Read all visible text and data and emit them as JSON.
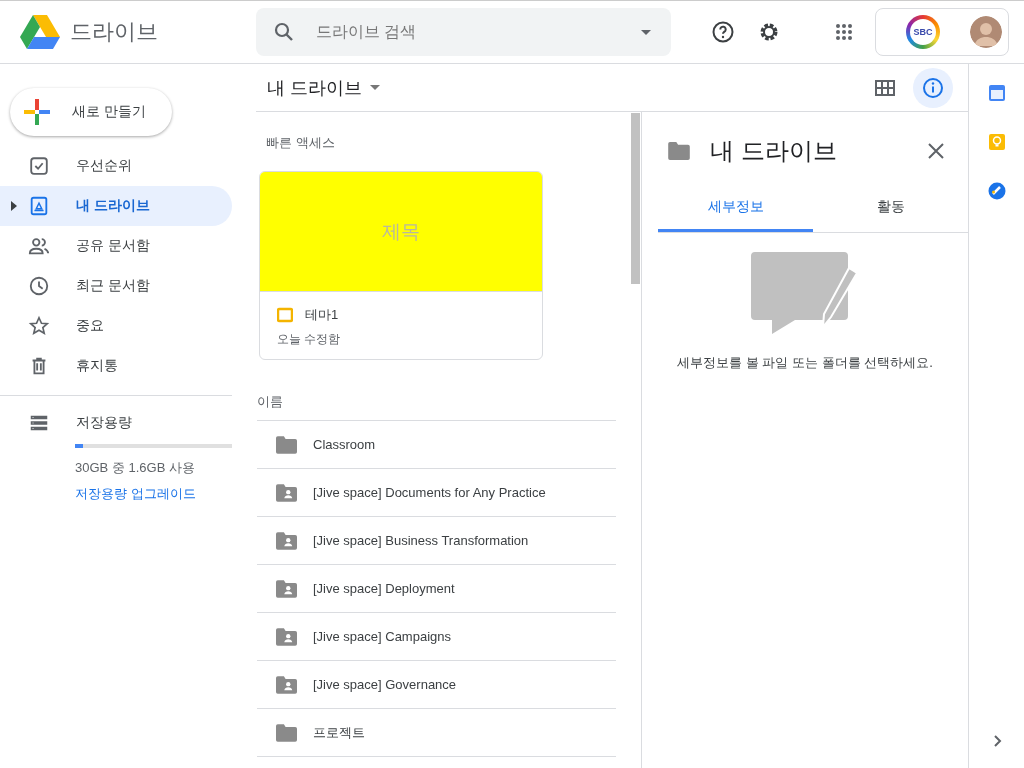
{
  "header": {
    "app_name": "드라이브",
    "search": {
      "placeholder": "드라이브 검색"
    },
    "account_logo": "SBC"
  },
  "sidebar": {
    "new_button": "새로 만들기",
    "items": [
      {
        "label": "우선순위",
        "kind": "priority",
        "selected": false
      },
      {
        "label": "내 드라이브",
        "kind": "drive",
        "selected": true
      },
      {
        "label": "공유 문서함",
        "kind": "shared",
        "selected": false
      },
      {
        "label": "최근 문서함",
        "kind": "recent",
        "selected": false
      },
      {
        "label": "중요",
        "kind": "starred",
        "selected": false
      },
      {
        "label": "휴지통",
        "kind": "trash",
        "selected": false
      }
    ],
    "storage": {
      "label": "저장용량",
      "level": 0.053,
      "usage": "30GB 중 1.6GB 사용",
      "upgrade": "저장용량 업그레이드"
    }
  },
  "main": {
    "title": "내 드라이브",
    "quick_access": {
      "heading": "빠른 액세스",
      "file": {
        "thumbnail_text": "제목",
        "name": "테마1",
        "modified": "오늘 수정함"
      }
    },
    "column_name": "이름",
    "files": [
      {
        "name": "Classroom",
        "kind": "folder"
      },
      {
        "name": "[Jive space] Documents for Any Practice",
        "kind": "shared"
      },
      {
        "name": "[Jive space] Business Transformation",
        "kind": "shared"
      },
      {
        "name": "[Jive space] Deployment",
        "kind": "shared"
      },
      {
        "name": "[Jive space] Campaigns",
        "kind": "shared"
      },
      {
        "name": "[Jive space] Governance",
        "kind": "shared"
      },
      {
        "name": "프로젝트",
        "kind": "folder"
      }
    ]
  },
  "details": {
    "title": "내 드라이브",
    "tabs": [
      {
        "label": "세부정보",
        "selected": true
      },
      {
        "label": "활동",
        "selected": false
      }
    ],
    "empty_message": "세부정보를 볼 파일 또는 폴더를 선택하세요."
  }
}
